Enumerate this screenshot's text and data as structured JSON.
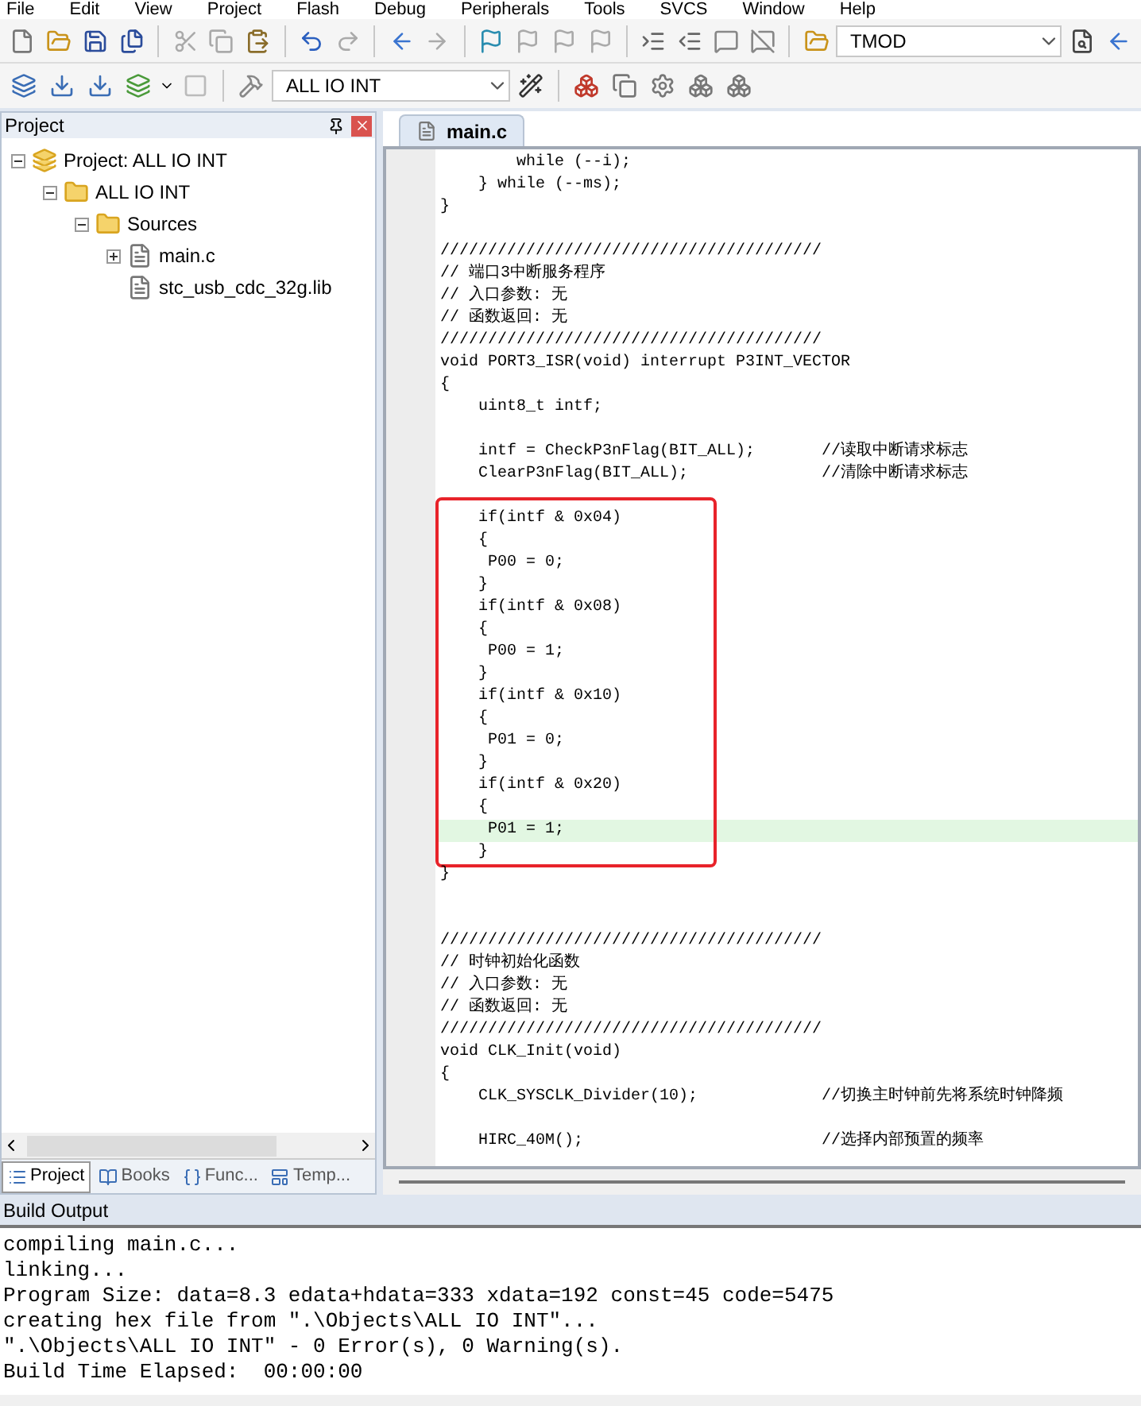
{
  "menu": [
    "File",
    "Edit",
    "View",
    "Project",
    "Flash",
    "Debug",
    "Peripherals",
    "Tools",
    "SVCS",
    "Window",
    "Help"
  ],
  "toolbar": {
    "find_combo": "TMOD",
    "target_combo": "ALL IO INT"
  },
  "project_panel": {
    "title": "Project",
    "tree": [
      {
        "label": "Project: ALL IO INT",
        "kind": "project",
        "expanded": true,
        "children": [
          {
            "label": "ALL IO INT",
            "kind": "target",
            "expanded": true,
            "children": [
              {
                "label": "Sources",
                "kind": "group",
                "expanded": true,
                "children": [
                  {
                    "label": "main.c",
                    "kind": "file",
                    "expanded": false
                  },
                  {
                    "label": "stc_usb_cdc_32g.lib",
                    "kind": "file"
                  }
                ]
              }
            ]
          }
        ]
      }
    ],
    "tabs": [
      {
        "label": "Project",
        "kind": "project",
        "selected": true
      },
      {
        "label": "Books",
        "kind": "books",
        "selected": false
      },
      {
        "label": "Func...",
        "kind": "functions",
        "selected": false
      },
      {
        "label": "Temp...",
        "kind": "templates",
        "selected": false
      }
    ]
  },
  "editor": {
    "tab": "main.c",
    "segments": [
      {
        "boxed": false,
        "lines": [
          {
            "text": "        while (--i);",
            "highlighted": false
          },
          {
            "text": "    } while (--ms);",
            "highlighted": false
          },
          {
            "text": "}",
            "highlighted": false
          },
          {
            "highlighted": false
          },
          {
            "text": "////////////////////////////////////////",
            "highlighted": false
          },
          {
            "text": "// 端口3中断服务程序",
            "highlighted": false
          },
          {
            "text": "// 入口参数: 无",
            "highlighted": false
          },
          {
            "text": "// 函数返回: 无",
            "highlighted": false
          },
          {
            "text": "////////////////////////////////////////",
            "highlighted": false
          },
          {
            "text": "void PORT3_ISR(void) interrupt P3INT_VECTOR",
            "highlighted": false
          },
          {
            "text": "{",
            "highlighted": false
          },
          {
            "text": "    uint8_t intf;",
            "highlighted": false
          },
          {
            "highlighted": false
          },
          {
            "text": "    intf = CheckP3nFlag(BIT_ALL);       //读取中断请求标志",
            "highlighted": false
          },
          {
            "text": "    ClearP3nFlag(BIT_ALL);              //清除中断请求标志",
            "highlighted": false
          },
          {
            "highlighted": false
          }
        ]
      },
      {
        "boxed": true,
        "lines": [
          {
            "text": "    if(intf & 0x04)",
            "highlighted": false
          },
          {
            "text": "    {",
            "highlighted": false
          },
          {
            "text": "     P00 = 0;",
            "highlighted": false
          },
          {
            "text": "    }",
            "highlighted": false
          },
          {
            "text": "    if(intf & 0x08)",
            "highlighted": false
          },
          {
            "text": "    {",
            "highlighted": false
          },
          {
            "text": "     P00 = 1;",
            "highlighted": false
          },
          {
            "text": "    }",
            "highlighted": false
          },
          {
            "text": "    if(intf & 0x10)",
            "highlighted": false
          },
          {
            "text": "    {",
            "highlighted": false
          },
          {
            "text": "     P01 = 0;",
            "highlighted": false
          },
          {
            "text": "    }",
            "highlighted": false
          },
          {
            "text": "    if(intf & 0x20)",
            "highlighted": false
          },
          {
            "text": "    {",
            "highlighted": false
          },
          {
            "text": "     P01 = 1;",
            "highlighted": true
          },
          {
            "text": "    }",
            "highlighted": false
          }
        ]
      },
      {
        "boxed": false,
        "lines": [
          {
            "text": "}",
            "highlighted": false
          },
          {
            "highlighted": false
          },
          {
            "highlighted": false
          },
          {
            "text": "////////////////////////////////////////",
            "highlighted": false
          },
          {
            "text": "// 时钟初始化函数",
            "highlighted": false
          },
          {
            "text": "// 入口参数: 无",
            "highlighted": false
          },
          {
            "text": "// 函数返回: 无",
            "highlighted": false
          },
          {
            "text": "////////////////////////////////////////",
            "highlighted": false
          },
          {
            "text": "void CLK_Init(void)",
            "highlighted": false
          },
          {
            "text": "{",
            "highlighted": false
          },
          {
            "text": "    CLK_SYSCLK_Divider(10);             //切换主时钟前先将系统时钟降频",
            "highlighted": false
          },
          {
            "highlighted": false
          },
          {
            "text": "    HIRC_40M();                         //选择内部预置的频率",
            "highlighted": false
          }
        ]
      }
    ]
  },
  "build_output": {
    "title": "Build Output",
    "lines": [
      "compiling main.c...",
      "linking...",
      "Program Size: data=8.3 edata+hdata=333 xdata=192 const=45 code=5475",
      "creating hex file from \".\\Objects\\ALL IO INT\"...",
      "\".\\Objects\\ALL IO INT\" - 0 Error(s), 0 Warning(s).",
      "Build Time Elapsed:  00:00:00"
    ]
  }
}
